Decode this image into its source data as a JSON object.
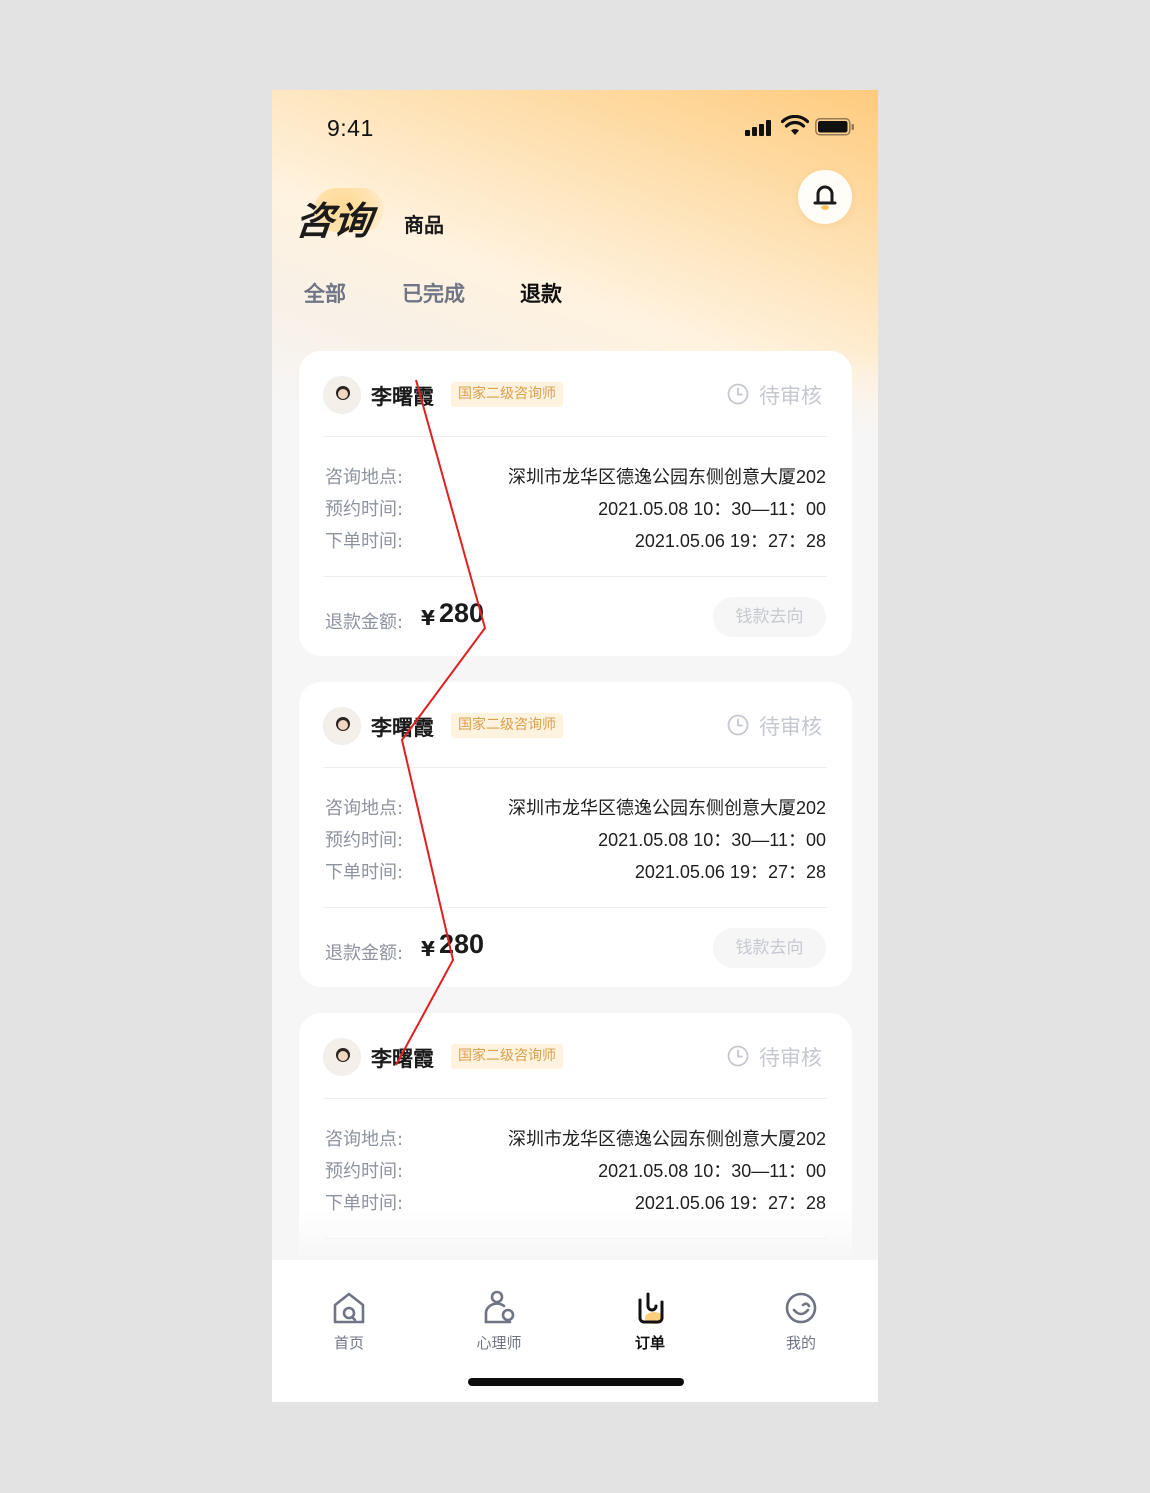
{
  "status_bar": {
    "time": "9:41"
  },
  "header": {
    "main_tabs": [
      {
        "label": "咨询",
        "active": true
      },
      {
        "label": "商品",
        "active": false
      }
    ],
    "sub_tabs": [
      {
        "label": "全部",
        "active": false
      },
      {
        "label": "已完成",
        "active": false
      },
      {
        "label": "退款",
        "active": true
      }
    ],
    "bell_icon": "bell-icon"
  },
  "orders": [
    {
      "name": "李曙霞",
      "badge": "国家二级咨询师",
      "status": "待审核",
      "location_label": "咨询地点:",
      "location": "深圳市龙华区德逸公园东侧创意大厦202",
      "appointment_label": "预约时间:",
      "appointment": "2021.05.08 10：30—11：00",
      "order_time_label": "下单时间:",
      "order_time": "2021.05.06 19：27：28",
      "refund_label": "退款金额:",
      "currency": "¥",
      "refund_amount": "280",
      "track_button": "钱款去向"
    },
    {
      "name": "李曙霞",
      "badge": "国家二级咨询师",
      "status": "待审核",
      "location_label": "咨询地点:",
      "location": "深圳市龙华区德逸公园东侧创意大厦202",
      "appointment_label": "预约时间:",
      "appointment": "2021.05.08 10：30—11：00",
      "order_time_label": "下单时间:",
      "order_time": "2021.05.06 19：27：28",
      "refund_label": "退款金额:",
      "currency": "¥",
      "refund_amount": "280",
      "track_button": "钱款去向"
    },
    {
      "name": "李曙霞",
      "badge": "国家二级咨询师",
      "status": "待审核",
      "location_label": "咨询地点:",
      "location": "深圳市龙华区德逸公园东侧创意大厦202",
      "appointment_label": "预约时间:",
      "appointment": "2021.05.08 10：30—11：00",
      "order_time_label": "下单时间:",
      "order_time": "2021.05.06 19：27：28"
    }
  ],
  "tabbar": [
    {
      "label": "首页",
      "icon": "home-icon",
      "active": false
    },
    {
      "label": "心理师",
      "icon": "therapist-icon",
      "active": false
    },
    {
      "label": "订单",
      "icon": "order-icon",
      "active": true
    },
    {
      "label": "我的",
      "icon": "profile-icon",
      "active": false
    }
  ],
  "colors": {
    "accent": "#fecb7e",
    "badge_text": "#d9a04e",
    "badge_bg": "#fff3e0",
    "annotation_line": "#e02020"
  }
}
